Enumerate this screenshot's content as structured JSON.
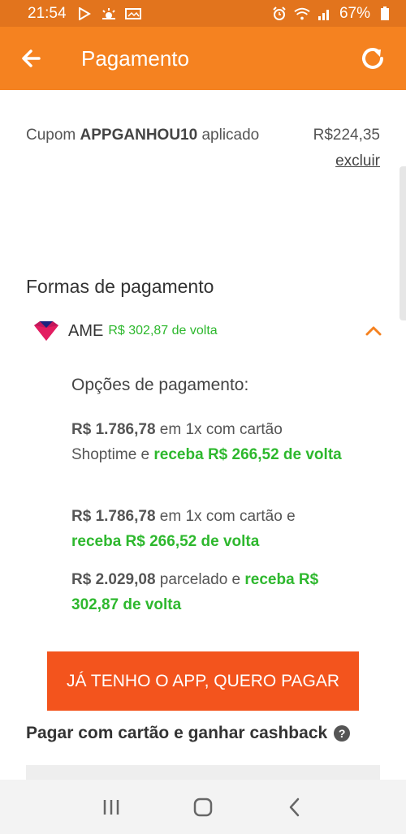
{
  "status_bar": {
    "time": "21:54",
    "battery": "67%"
  },
  "app_bar": {
    "title": "Pagamento"
  },
  "coupon": {
    "prefix": "Cupom",
    "code": "APPGANHOU10",
    "suffix": "aplicado",
    "value": "R$224,35",
    "remove_label": "excluir"
  },
  "payment_methods": {
    "title": "Formas de pagamento",
    "ame": {
      "name": "AME",
      "cashback": "R$ 302,87 de volta"
    },
    "options_title": "Opções de pagamento:",
    "options": [
      {
        "price": "R$ 1.786,78",
        "text": " em 1x com cartão Shoptime e ",
        "green": "receba R$ 266,52 de volta"
      },
      {
        "price": "R$ 1.786,78",
        "text": " em 1x com cartão e ",
        "green": "receba R$ 266,52 de volta"
      },
      {
        "price": "R$ 2.029,08",
        "text": " parcelado e ",
        "green": "receba R$ 302,87 de volta"
      }
    ]
  },
  "cta_label": "JÁ TENHO O APP, QUERO PAGAR",
  "card_section": {
    "title": "Pagar com cartão e ganhar cashback",
    "help_glyph": "?"
  },
  "colors": {
    "app_bar": "#f58220",
    "status_bar": "#e2741d",
    "cta": "#f3541d",
    "cashback_green": "#2eb82e"
  }
}
